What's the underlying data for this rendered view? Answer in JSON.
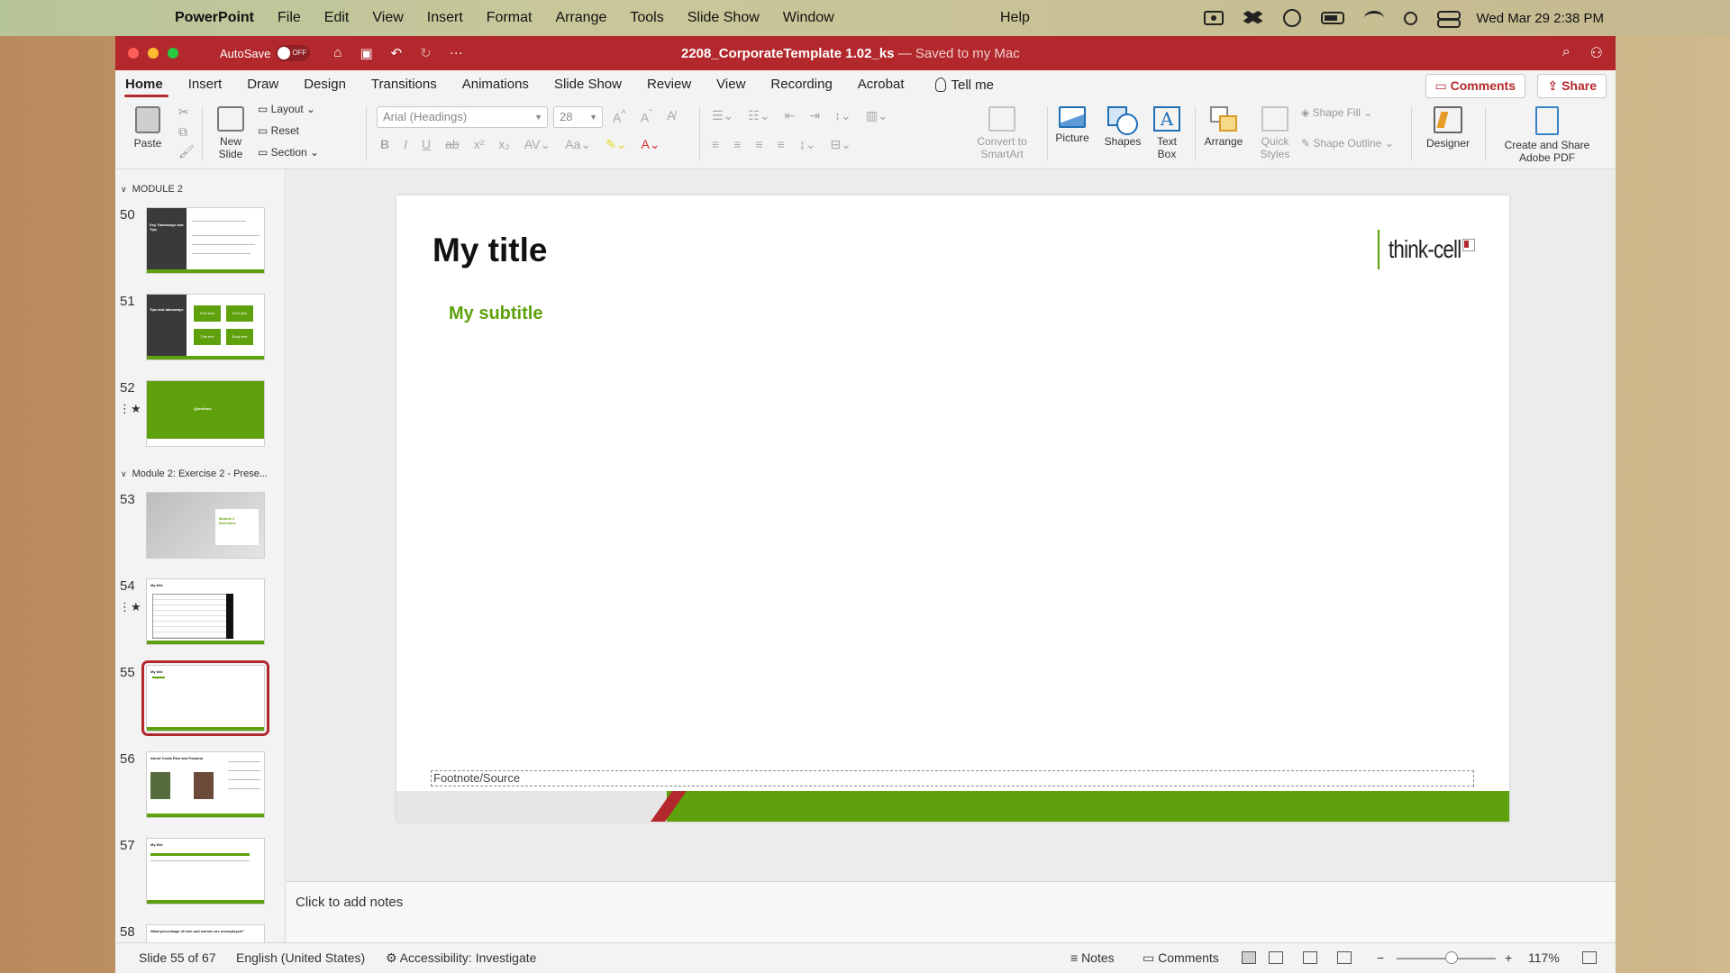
{
  "menubar": {
    "app_name": "PowerPoint",
    "items": [
      "File",
      "Edit",
      "View",
      "Insert",
      "Format",
      "Arrange",
      "Tools",
      "Slide Show",
      "Window"
    ],
    "help": "Help",
    "clock": "Wed Mar 29  2:38 PM"
  },
  "window": {
    "autosave_label": "AutoSave",
    "autosave_state": "OFF",
    "doc_name": "2208_CorporateTemplate 1.02_ks",
    "doc_status": "— Saved to my Mac"
  },
  "tabs": [
    "Home",
    "Insert",
    "Draw",
    "Design",
    "Transitions",
    "Animations",
    "Slide Show",
    "Review",
    "View",
    "Recording",
    "Acrobat"
  ],
  "tell_me": "Tell me",
  "comments_btn": "Comments",
  "share_btn": "Share",
  "ribbon": {
    "paste": "Paste",
    "new_slide": "New\nSlide",
    "new_slide_1": "New",
    "new_slide_2": "Slide",
    "layout": "Layout",
    "reset": "Reset",
    "section": "Section",
    "font_name": "Arial (Headings)",
    "font_size": "28",
    "smartart_1": "Convert to",
    "smartart_2": "SmartArt",
    "picture": "Picture",
    "shapes": "Shapes",
    "textbox_1": "Text",
    "textbox_2": "Box",
    "arrange": "Arrange",
    "quick_styles_1": "Quick",
    "quick_styles_2": "Styles",
    "shape_fill": "Shape Fill",
    "shape_outline": "Shape Outline",
    "designer": "Designer",
    "create_pdf_1": "Create and Share",
    "create_pdf_2": "Adobe PDF"
  },
  "thumbs": {
    "section1": "MODULE 2",
    "section2": "Module 2: Exercise 2 - Prese...",
    "slide_numbers": [
      "50",
      "51",
      "52",
      "53",
      "54",
      "55",
      "56",
      "57",
      "58"
    ],
    "t50_title": "Key Takeaways and Tips",
    "t51_title": "Tips and takeaways",
    "t51_boxes": [
      "Font face",
      "Font size",
      "Title text",
      "Body text"
    ],
    "t52_title": "Questions",
    "t53_title": "Module 2 Exercises",
    "t54_title": "My title",
    "t55_title": "My title",
    "t56_title": "About Costa Rica and Panama",
    "t57_title": "My title",
    "t58_title": "What percentage of men and women are unemployed?"
  },
  "slide": {
    "title": "My title",
    "subtitle": "My subtitle",
    "logo_text": "think-cell",
    "footnote": "Footnote/Source"
  },
  "notes_placeholder": "Click to add notes",
  "status": {
    "slide_count": "Slide 55 of 67",
    "language": "English (United States)",
    "accessibility": "Accessibility: Investigate",
    "notes": "Notes",
    "comments": "Comments",
    "zoom": "117%"
  },
  "colors": {
    "accent_red": "#b3282d",
    "brand_green": "#5ea10c"
  }
}
